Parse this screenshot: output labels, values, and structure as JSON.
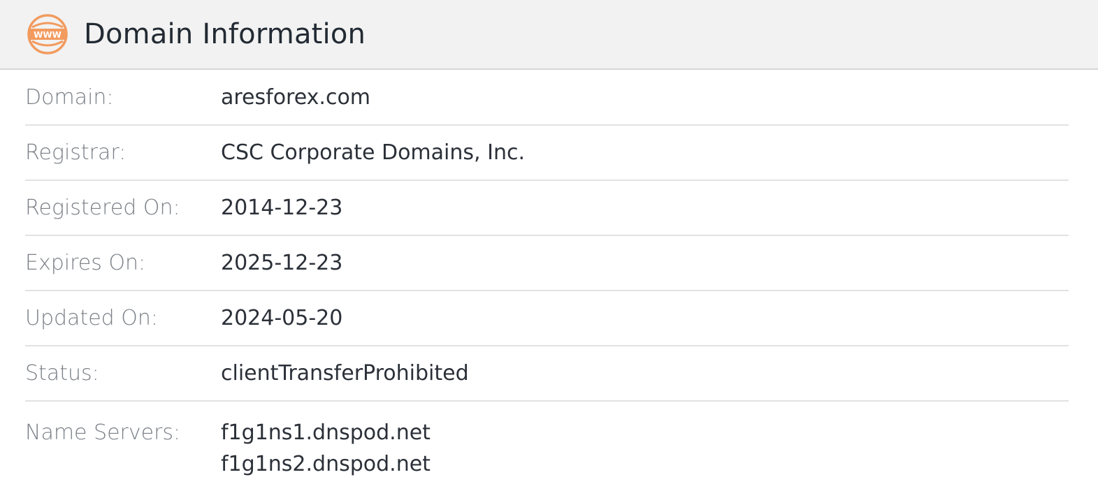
{
  "header": {
    "icon": "www-globe-icon",
    "icon_text": "WWW",
    "title": "Domain Information",
    "accent_color": "#f29b5f"
  },
  "rows": [
    {
      "label": "Domain:",
      "value": "aresforex.com"
    },
    {
      "label": "Registrar:",
      "value": "CSC Corporate Domains, Inc."
    },
    {
      "label": "Registered On:",
      "value": "2014-12-23"
    },
    {
      "label": "Expires On:",
      "value": "2025-12-23"
    },
    {
      "label": "Updated On:",
      "value": "2024-05-20"
    },
    {
      "label": "Status:",
      "value": "clientTransferProhibited"
    }
  ],
  "name_servers": {
    "label": "Name Servers:",
    "values": [
      "f1g1ns1.dnspod.net",
      "f1g1ns2.dnspod.net"
    ]
  }
}
